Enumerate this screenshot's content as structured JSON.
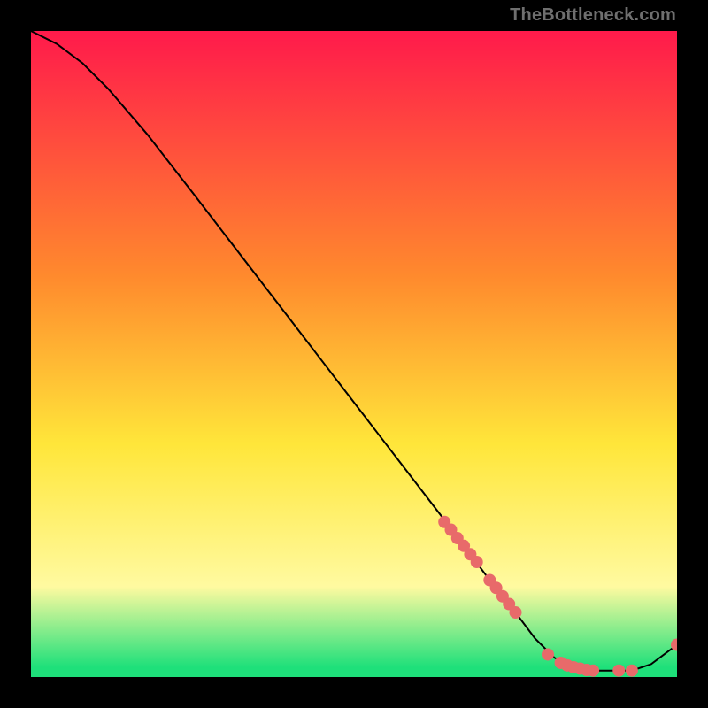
{
  "watermark": "TheBottleneck.com",
  "colors": {
    "top_red": "#ff1a4b",
    "mid_orange": "#ff8a2d",
    "mid_yellow": "#ffe63a",
    "pale_yellow": "#fffaa0",
    "green": "#1ee07a",
    "marker": "#e86a6a",
    "curve": "#000000",
    "outer": "#000000"
  },
  "chart_data": {
    "type": "line",
    "title": "",
    "xlabel": "",
    "ylabel": "",
    "xlim": [
      0,
      100
    ],
    "ylim": [
      0,
      100
    ],
    "series": [
      {
        "name": "bottleneck-curve",
        "x": [
          0,
          4,
          8,
          12,
          18,
          25,
          35,
          45,
          55,
          65,
          71,
          75,
          78,
          81,
          84,
          87,
          90,
          93,
          96,
          100
        ],
        "y": [
          100,
          98,
          95,
          91,
          84,
          75,
          62,
          49,
          36,
          23,
          15,
          10,
          6,
          3,
          1.5,
          1,
          1,
          1,
          2,
          5
        ]
      }
    ],
    "markers": [
      {
        "name": "cluster-a",
        "x": 64.0,
        "y": 24.0
      },
      {
        "name": "cluster-a",
        "x": 65.0,
        "y": 22.8
      },
      {
        "name": "cluster-a",
        "x": 66.0,
        "y": 21.5
      },
      {
        "name": "cluster-a",
        "x": 67.0,
        "y": 20.3
      },
      {
        "name": "cluster-a",
        "x": 68.0,
        "y": 19.0
      },
      {
        "name": "cluster-a",
        "x": 69.0,
        "y": 17.8
      },
      {
        "name": "cluster-b",
        "x": 71.0,
        "y": 15.0
      },
      {
        "name": "cluster-b",
        "x": 72.0,
        "y": 13.8
      },
      {
        "name": "cluster-b",
        "x": 73.0,
        "y": 12.5
      },
      {
        "name": "cluster-b",
        "x": 74.0,
        "y": 11.3
      },
      {
        "name": "cluster-b",
        "x": 75.0,
        "y": 10.0
      },
      {
        "name": "flat-c",
        "x": 80.0,
        "y": 3.5
      },
      {
        "name": "flat-c",
        "x": 82.0,
        "y": 2.2
      },
      {
        "name": "flat-c",
        "x": 83.0,
        "y": 1.8
      },
      {
        "name": "flat-c",
        "x": 84.0,
        "y": 1.5
      },
      {
        "name": "flat-c",
        "x": 85.0,
        "y": 1.3
      },
      {
        "name": "flat-c",
        "x": 86.0,
        "y": 1.1
      },
      {
        "name": "flat-c",
        "x": 87.0,
        "y": 1.0
      },
      {
        "name": "flat-d",
        "x": 91.0,
        "y": 1.0
      },
      {
        "name": "flat-d",
        "x": 93.0,
        "y": 1.0
      },
      {
        "name": "tail-e",
        "x": 100.0,
        "y": 5.0
      }
    ]
  }
}
